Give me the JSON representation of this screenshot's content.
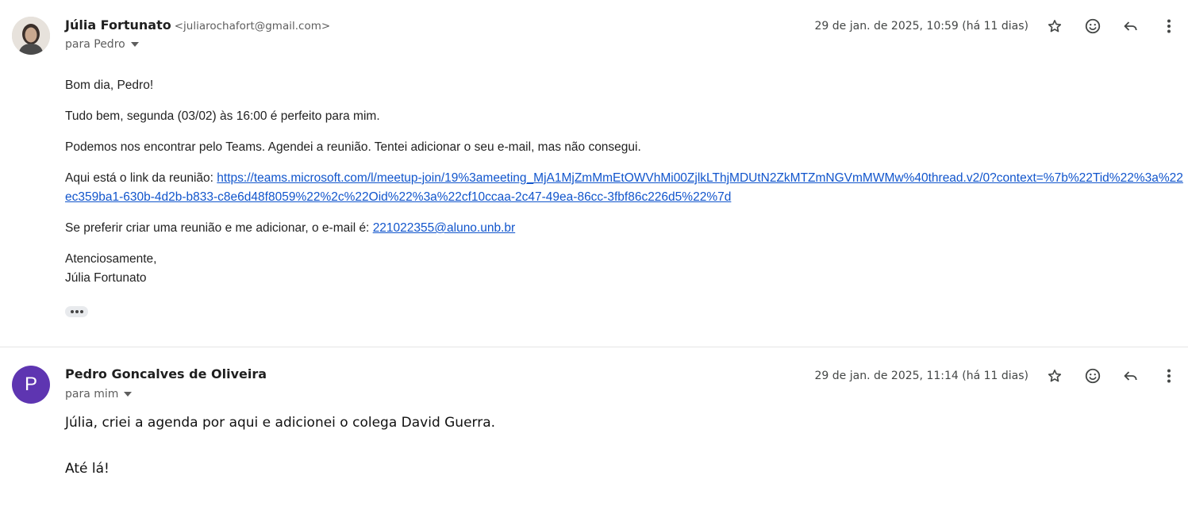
{
  "messages": [
    {
      "sender": "Júlia Fortunato",
      "email": "<juliarochafort@gmail.com>",
      "recipient": "para Pedro",
      "date": "29 de jan. de 2025, 10:59 (há 11 dias)",
      "avatar_icon": "person-photo",
      "body": {
        "greeting": "Bom dia, Pedro!",
        "line1": "Tudo bem, segunda (03/02) às 16:00 é perfeito para mim.",
        "line2": "Podemos nos encontrar pelo Teams. Agendei a reunião. Tentei adicionar o seu e-mail, mas não consegui.",
        "link_prefix": "Aqui está o link da reunião: ",
        "link": "https://teams.microsoft.com/l/meetup-join/19%3ameeting_MjA1MjZmMmEtOWVhMi00ZjlkLThjMDUtN2ZkMTZmNGVmMWMw%40thread.v2/0?context=%7b%22Tid%22%3a%22ec359ba1-630b-4d2b-b833-c8e6d48f8059%22%2c%22Oid%22%3a%22cf10ccaa-2c47-49ea-86cc-3fbf86c226d5%22%7d",
        "email_prefix": "Se preferir criar uma reunião e me adicionar, o e-mail é: ",
        "email_link": "221022355@aluno.unb.br",
        "closing": "Atenciosamente,",
        "signature": "Júlia Fortunato"
      }
    },
    {
      "sender": "Pedro Goncalves de Oliveira",
      "avatar_letter": "P",
      "recipient": "para mim",
      "date": "29 de jan. de 2025, 11:14 (há 11 dias)",
      "body": {
        "line1": "Júlia, criei a agenda por aqui e adicionei o colega David Guerra.",
        "line2": "Até lá!"
      }
    }
  ],
  "icons": {
    "star": "star-icon",
    "emoji": "emoji-icon",
    "reply": "reply-icon",
    "more": "more-vert-icon",
    "caret": "caret-down-icon"
  },
  "colors": {
    "link": "#1155cc",
    "avatar_p": "#5e35b1"
  }
}
